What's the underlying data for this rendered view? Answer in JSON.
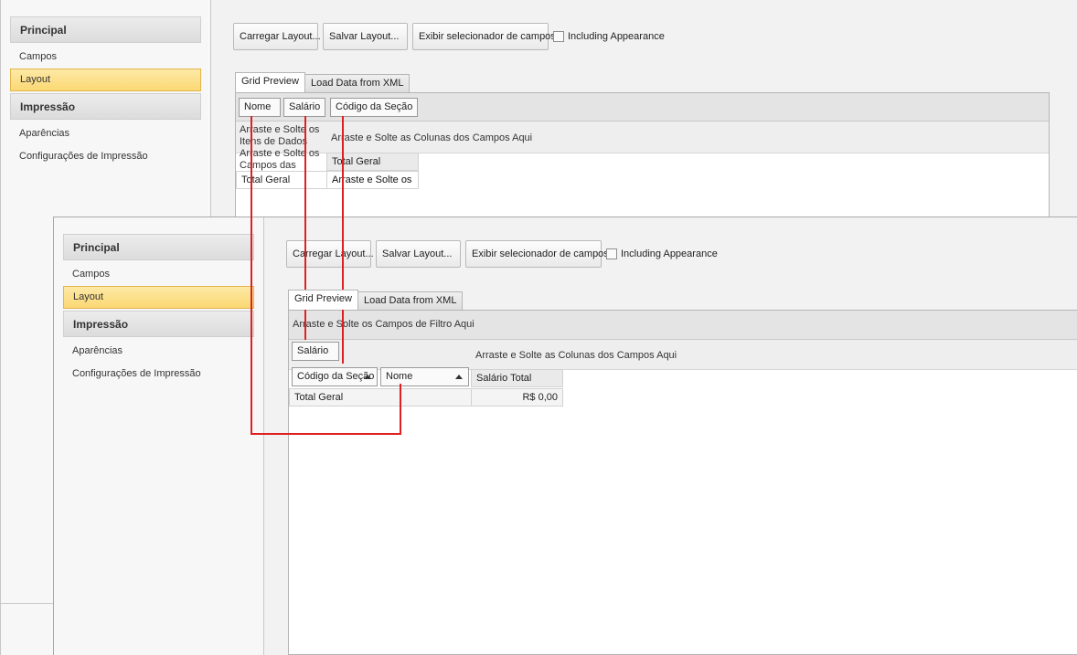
{
  "nav": {
    "group_principal": "Principal",
    "item_campos": "Campos",
    "item_layout": "Layout",
    "group_impressao": "Impressão",
    "item_aparencias": "Aparências",
    "item_config": "Configurações de Impressão"
  },
  "toolbar": {
    "load_layout": "Carregar Layout...",
    "save_layout": "Salvar Layout...",
    "field_chooser": "Exibir selecionador de campos",
    "including_appearance": "Including Appearance"
  },
  "tabs": {
    "grid_preview": "Grid Preview",
    "load_xml": "Load Data from XML"
  },
  "before": {
    "filter_fields": [
      "Nome",
      "Salário",
      "Código da Seção"
    ],
    "data_hint": "Arraste e Solte os Itens de Dados",
    "column_hint": "Arraste e Solte as Colunas dos Campos Aqui",
    "row_hint": "Arraste e Solte os Campos das Linhas",
    "total_header": "Total Geral",
    "total_row": "Total Geral",
    "drop_cell": "Arraste e Solte os"
  },
  "after": {
    "filter_hint": "Arraste e Solte os Campos de Filtro Aqui",
    "data_field": "Salário",
    "column_hint": "Arraste e Solte as Colunas dos Campos Aqui",
    "row_field_1": "Código da Seção",
    "row_field_2": "Nome",
    "value_header": "Salário Total",
    "total_row": "Total Geral",
    "total_value": "R$ 0,00"
  },
  "colors": {
    "selection": "#fbd873",
    "connector": "#e02020"
  }
}
